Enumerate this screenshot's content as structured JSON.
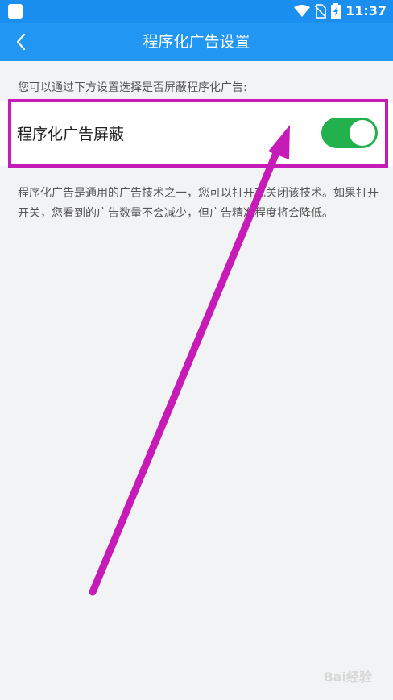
{
  "status_bar": {
    "time": "11:37",
    "icons": [
      "wifi-icon",
      "no-sim-icon",
      "battery-charging-icon"
    ]
  },
  "header": {
    "title": "程序化广告设置",
    "back_icon": "chevron-left-icon"
  },
  "intro_text": "您可以通过下方设置选择是否屏蔽程序化广告:",
  "setting": {
    "label": "程序化广告屏蔽",
    "enabled": true
  },
  "description": "程序化广告是通用的广告技术之一，您可以打开或关闭该技术。如果打开开关，您看到的广告数量不会减少，但广告精准程度将会降低。",
  "annotation": {
    "highlight_color": "#c71bb8",
    "arrow_color": "#c71bb8"
  },
  "watermark": "Bai经验"
}
